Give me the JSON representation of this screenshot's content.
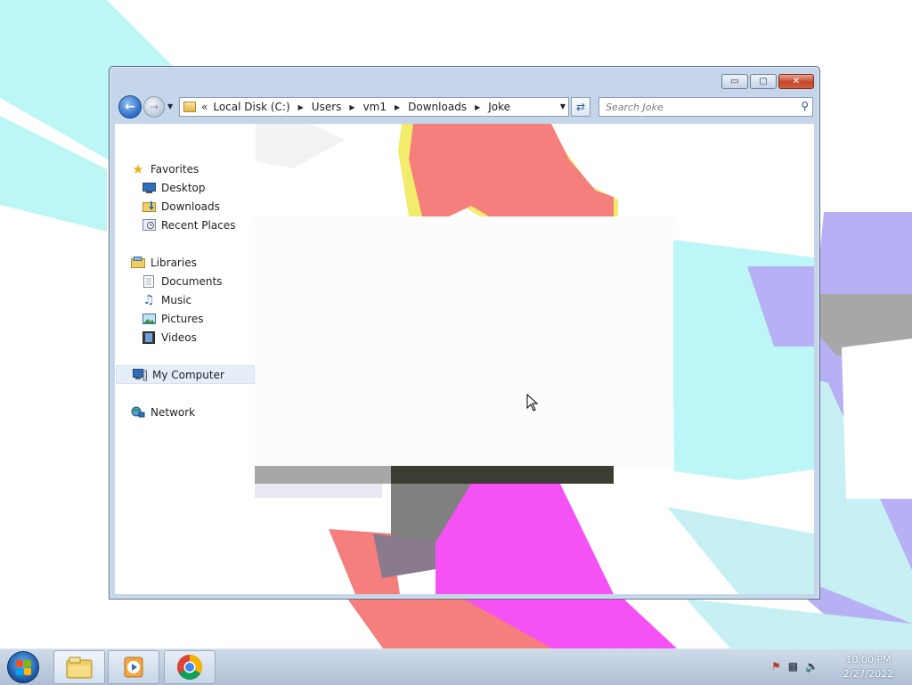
{
  "explorer": {
    "caption_buttons": {
      "minimize": "▭",
      "maximize": "▢",
      "close": "✕"
    },
    "address": {
      "chevron": "«",
      "crumbs": [
        "Local Disk (C:)",
        "Users",
        "vm1",
        "Downloads",
        "Joke"
      ]
    },
    "search": {
      "placeholder": "Search Joke"
    },
    "nav_pane": {
      "favorites": {
        "label": "Favorites",
        "icon": "star-icon"
      },
      "favorites_items": [
        {
          "label": "Desktop",
          "icon": "desktop-icon"
        },
        {
          "label": "Downloads",
          "icon": "downloads-folder-icon"
        },
        {
          "label": "Recent Places",
          "icon": "recent-places-icon"
        }
      ],
      "libraries": {
        "label": "Libraries",
        "icon": "library-icon"
      },
      "libraries_items": [
        {
          "label": "Documents",
          "icon": "documents-icon"
        },
        {
          "label": "Music",
          "icon": "music-note-icon"
        },
        {
          "label": "Pictures",
          "icon": "pictures-icon"
        },
        {
          "label": "Videos",
          "icon": "film-icon"
        }
      ],
      "computer": {
        "label": "My Computer",
        "icon": "computer-icon",
        "selected": true
      },
      "network": {
        "label": "Network",
        "icon": "network-icon"
      }
    }
  },
  "taskbar": {
    "pinned": [
      {
        "name": "windows-explorer",
        "icon": "explorer-folder-icon",
        "active": true
      },
      {
        "name": "media-player",
        "icon": "media-player-icon",
        "active": false
      },
      {
        "name": "chrome",
        "icon": "chrome-icon",
        "active": false
      }
    ],
    "tray_icons": [
      "action-center-flag-icon",
      "network-tray-icon",
      "speaker-icon"
    ],
    "clock": {
      "time": "10:00 PM",
      "date": "2/27/2022"
    }
  },
  "colors": {
    "accent": "#2c6cc4",
    "glitch_red": "#f47f7c",
    "glitch_magenta": "#f552f5",
    "glitch_cyan": "#bdf6f6",
    "glitch_purple": "#b7b0f5",
    "glitch_gray": "#808080"
  }
}
